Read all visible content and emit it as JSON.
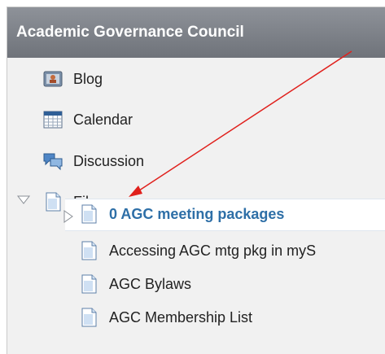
{
  "header": {
    "title": "Academic Governance Council"
  },
  "nav": {
    "blog": "Blog",
    "calendar": "Calendar",
    "discussion": "Discussion",
    "files": "Files"
  },
  "files": {
    "items": [
      "0 AGC meeting packages",
      "Accessing AGC mtg pkg in myS",
      "AGC Bylaws",
      "AGC Membership List"
    ]
  },
  "colors": {
    "header": "#7f838a",
    "accent": "#2e6fa7",
    "annotation": "#e0201c"
  },
  "icons": [
    "blog-icon",
    "calendar-icon",
    "discussion-icon",
    "file-icon",
    "expand-triangle-icon",
    "collapse-triangle-icon"
  ]
}
